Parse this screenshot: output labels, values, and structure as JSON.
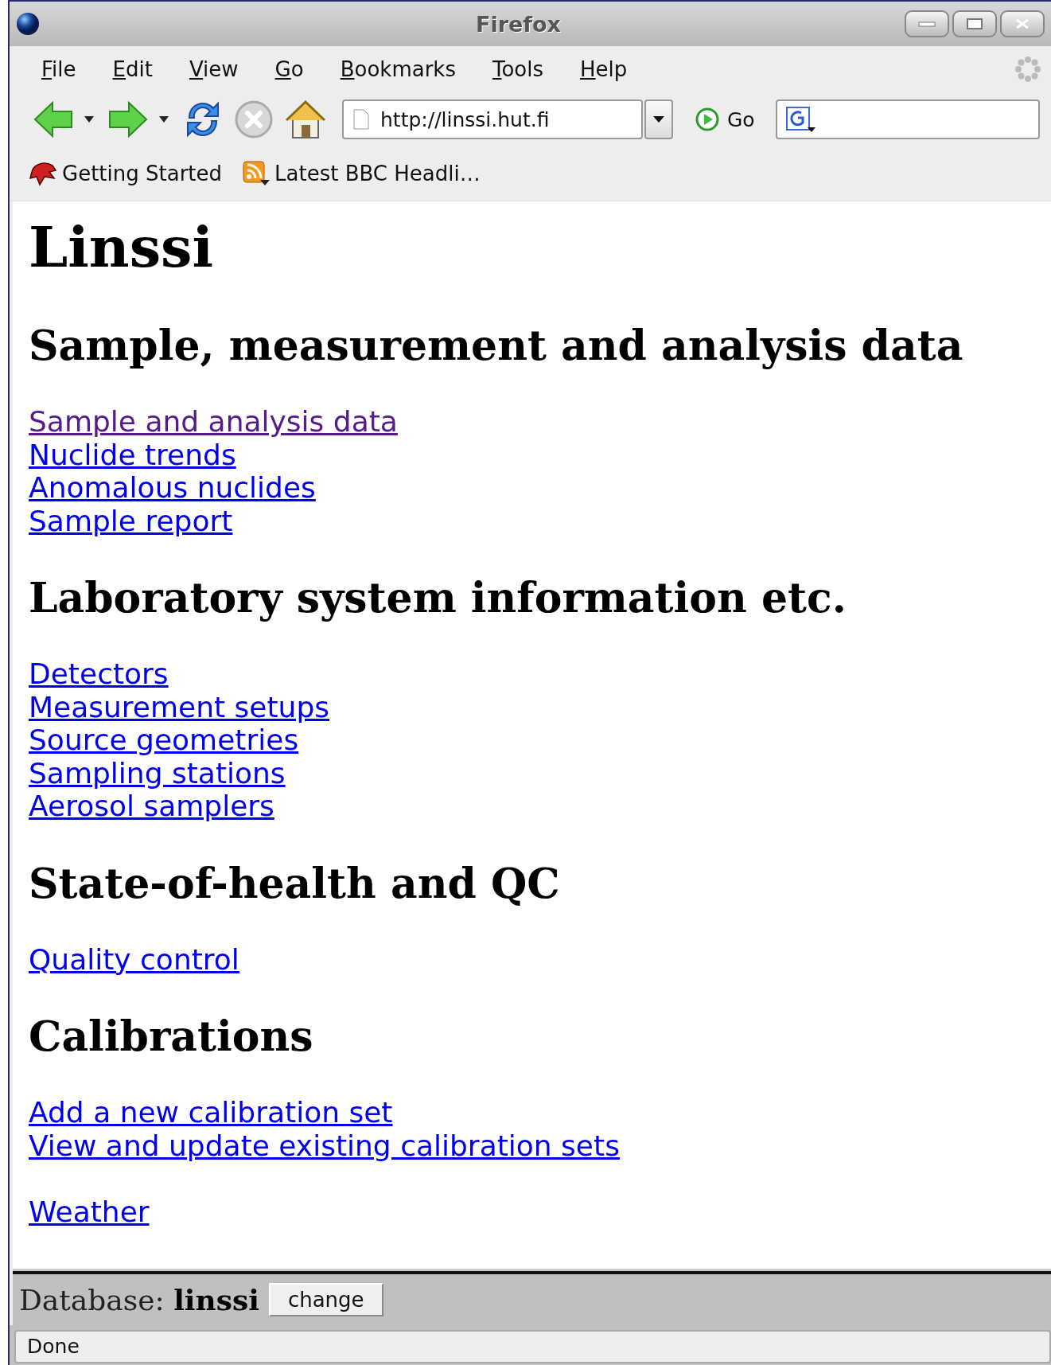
{
  "window": {
    "title": "Firefox"
  },
  "menu": [
    {
      "label": "File"
    },
    {
      "label": "Edit"
    },
    {
      "label": "View"
    },
    {
      "label": "Go"
    },
    {
      "label": "Bookmarks"
    },
    {
      "label": "Tools"
    },
    {
      "label": "Help"
    }
  ],
  "address_bar": {
    "value": "http://linssi.hut.fi"
  },
  "go_button": {
    "label": "Go"
  },
  "bookmarks": [
    {
      "label": "Getting Started",
      "kind": "page"
    },
    {
      "label": "Latest BBC Headli…",
      "kind": "feed"
    }
  ],
  "page": {
    "title": "Linssi",
    "sections": [
      {
        "heading": "Sample, measurement and analysis data",
        "links": [
          {
            "text": "Sample and analysis data",
            "visited": true
          },
          {
            "text": "Nuclide trends",
            "visited": false
          },
          {
            "text": "Anomalous nuclides",
            "visited": false
          },
          {
            "text": "Sample report",
            "visited": false
          }
        ]
      },
      {
        "heading": "Laboratory system information etc.",
        "links": [
          {
            "text": "Detectors",
            "visited": false
          },
          {
            "text": "Measurement setups",
            "visited": false
          },
          {
            "text": "Source geometries",
            "visited": false
          },
          {
            "text": "Sampling stations",
            "visited": false
          },
          {
            "text": "Aerosol samplers",
            "visited": false
          }
        ]
      },
      {
        "heading": "State-of-health and QC",
        "links": [
          {
            "text": "Quality control",
            "visited": false
          }
        ]
      },
      {
        "heading": "Calibrations",
        "links": [
          {
            "text": "Add a new calibration set",
            "visited": false
          },
          {
            "text": "View and update existing calibration sets",
            "visited": false
          }
        ]
      },
      {
        "links": [
          {
            "text": "Weather",
            "visited": false
          }
        ]
      }
    ]
  },
  "database_bar": {
    "text": "Database: **linssi**",
    "button": "change"
  },
  "status_bar": {
    "text": "Done"
  }
}
